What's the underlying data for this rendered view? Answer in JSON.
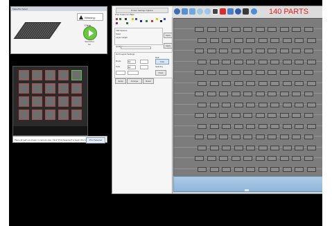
{
  "printer_window": {
    "title": "MakerBot Select",
    "warning_label": "Warning: Clear",
    "go_label": "Start Print",
    "go_sublabel": "Go"
  },
  "camera": {
    "status_text": "Place all parts as shown in camera view. Click \"Print Selected\" to begin this print.",
    "status_button": "Print Selected"
  },
  "settings_panel": {
    "header": "Printer Settings Options",
    "filament_label": "Print Colors for Plate",
    "infill_label": "Infill Options",
    "infill_value": "Solid",
    "layer_label": "Layer Height",
    "apply_button": "Apply",
    "quality_label": "Quality",
    "grid_label": "Grid Layout Settings",
    "raft_label": "Raft",
    "rows_label": "Rows",
    "rows_value": "12",
    "cols_label": "Cols",
    "cols_value": "10",
    "spacing_label": "Spacing",
    "auto_button": "Auto",
    "clear_button": "Clear",
    "arrange_button": "Arrange",
    "reset_button": "Reset"
  },
  "toolbar": {
    "parts_count": "140 PARTS",
    "icons": [
      "gear-icon",
      "save-icon",
      "open-icon",
      "zoom-in-icon",
      "zoom-out-icon",
      "check-icon",
      "warning-icon",
      "print-icon",
      "globe-icon",
      "camera-icon",
      "info-icon"
    ]
  },
  "colors": {
    "parts_count": "#e02020",
    "build_area": "#7c7c7c",
    "bottom_bar": "#9fc0e0",
    "camera_highlight": "#5ec04a",
    "camera_cell_border": "#b04848"
  }
}
